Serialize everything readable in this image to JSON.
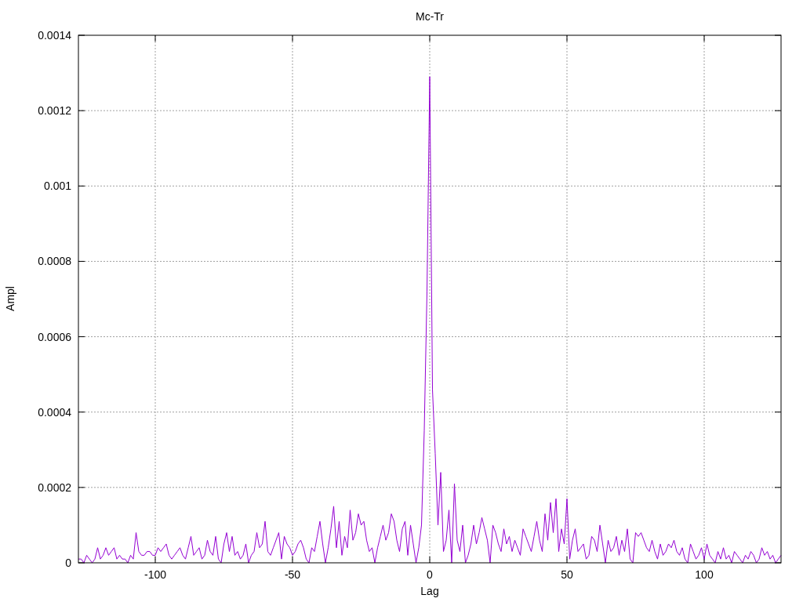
{
  "chart_data": {
    "type": "line",
    "title": "Mc-Tr",
    "xlabel": "Lag",
    "ylabel": "Ampl",
    "xlim": [
      -128,
      128
    ],
    "ylim": [
      0,
      0.0014
    ],
    "xticks": [
      -100,
      -50,
      0,
      50,
      100
    ],
    "yticks": [
      {
        "value": 0,
        "label": "0"
      },
      {
        "value": 0.0002,
        "label": "0.0002"
      },
      {
        "value": 0.0004,
        "label": "0.0004"
      },
      {
        "value": 0.0006,
        "label": "0.0006"
      },
      {
        "value": 0.0008,
        "label": "0.0008"
      },
      {
        "value": 0.001,
        "label": "0.001"
      },
      {
        "value": 0.0012,
        "label": "0.0012"
      },
      {
        "value": 0.0014,
        "label": "0.0014"
      }
    ],
    "grid": true,
    "x": [
      -128,
      -127,
      -126,
      -125,
      -124,
      -123,
      -122,
      -121,
      -120,
      -119,
      -118,
      -117,
      -116,
      -115,
      -114,
      -113,
      -112,
      -111,
      -110,
      -109,
      -108,
      -107,
      -106,
      -105,
      -104,
      -103,
      -102,
      -101,
      -100,
      -99,
      -98,
      -97,
      -96,
      -95,
      -94,
      -93,
      -92,
      -91,
      -90,
      -89,
      -88,
      -87,
      -86,
      -85,
      -84,
      -83,
      -82,
      -81,
      -80,
      -79,
      -78,
      -77,
      -76,
      -75,
      -74,
      -73,
      -72,
      -71,
      -70,
      -69,
      -68,
      -67,
      -66,
      -65,
      -64,
      -63,
      -62,
      -61,
      -60,
      -59,
      -58,
      -57,
      -56,
      -55,
      -54,
      -53,
      -52,
      -51,
      -50,
      -49,
      -48,
      -47,
      -46,
      -45,
      -44,
      -43,
      -42,
      -41,
      -40,
      -39,
      -38,
      -37,
      -36,
      -35,
      -34,
      -33,
      -32,
      -31,
      -30,
      -29,
      -28,
      -27,
      -26,
      -25,
      -24,
      -23,
      -22,
      -21,
      -20,
      -19,
      -18,
      -17,
      -16,
      -15,
      -14,
      -13,
      -12,
      -11,
      -10,
      -9,
      -8,
      -7,
      -6,
      -5,
      -4,
      -3,
      -2,
      -1,
      0,
      1,
      2,
      3,
      4,
      5,
      6,
      7,
      8,
      9,
      10,
      11,
      12,
      13,
      14,
      15,
      16,
      17,
      18,
      19,
      20,
      21,
      22,
      23,
      24,
      25,
      26,
      27,
      28,
      29,
      30,
      31,
      32,
      33,
      34,
      35,
      36,
      37,
      38,
      39,
      40,
      41,
      42,
      43,
      44,
      45,
      46,
      47,
      48,
      49,
      50,
      51,
      52,
      53,
      54,
      55,
      56,
      57,
      58,
      59,
      60,
      61,
      62,
      63,
      64,
      65,
      66,
      67,
      68,
      69,
      70,
      71,
      72,
      73,
      74,
      75,
      76,
      77,
      78,
      79,
      80,
      81,
      82,
      83,
      84,
      85,
      86,
      87,
      88,
      89,
      90,
      91,
      92,
      93,
      94,
      95,
      96,
      97,
      98,
      99,
      100,
      101,
      102,
      103,
      104,
      105,
      106,
      107,
      108,
      109,
      110,
      111,
      112,
      113,
      114,
      115,
      116,
      117,
      118,
      119,
      120,
      121,
      122,
      123,
      124,
      125,
      126,
      127,
      128
    ],
    "series": [
      {
        "color": "#9400d3",
        "values": [
          1e-05,
          1e-05,
          0.0,
          2e-05,
          1e-05,
          0.0,
          1e-05,
          4e-05,
          1e-05,
          2e-05,
          4e-05,
          2e-05,
          3e-05,
          4e-05,
          1e-05,
          2e-05,
          1e-05,
          1e-05,
          0.0,
          2e-05,
          1e-05,
          8e-05,
          3e-05,
          2e-05,
          2e-05,
          3e-05,
          3e-05,
          2e-05,
          2e-05,
          4e-05,
          3e-05,
          4e-05,
          5e-05,
          2e-05,
          1e-05,
          2e-05,
          3e-05,
          4e-05,
          2e-05,
          1e-05,
          4e-05,
          7e-05,
          2e-05,
          3e-05,
          4e-05,
          1e-05,
          2e-05,
          6e-05,
          3e-05,
          2e-05,
          7e-05,
          1e-05,
          0.0,
          5e-05,
          8e-05,
          3e-05,
          7e-05,
          2e-05,
          3e-05,
          1e-05,
          2e-05,
          5e-05,
          0.0,
          2e-05,
          3e-05,
          8e-05,
          4e-05,
          5e-05,
          0.00011,
          3e-05,
          2e-05,
          4e-05,
          6e-05,
          8e-05,
          1e-05,
          7e-05,
          5e-05,
          4e-05,
          2e-05,
          3e-05,
          5e-05,
          6e-05,
          4e-05,
          1e-05,
          0.0,
          4e-05,
          3e-05,
          7e-05,
          0.00011,
          5e-05,
          0.0,
          4e-05,
          9e-05,
          0.00015,
          4e-05,
          0.00011,
          2e-05,
          7e-05,
          4e-05,
          0.00014,
          6e-05,
          8e-05,
          0.00013,
          0.0001,
          0.00011,
          6e-05,
          3e-05,
          4e-05,
          0.0,
          4e-05,
          7e-05,
          0.0001,
          6e-05,
          8e-05,
          0.00013,
          0.00011,
          6e-05,
          3e-05,
          9e-05,
          0.00011,
          2e-05,
          0.0001,
          5e-05,
          0.0,
          4e-05,
          0.0001,
          0.00035,
          0.00072,
          0.00129,
          0.00046,
          0.00029,
          0.0001,
          0.00024,
          3e-05,
          6e-05,
          0.00014,
          0.0,
          0.00021,
          6e-05,
          3e-05,
          0.0001,
          0.0,
          2e-05,
          5e-05,
          0.0001,
          5e-05,
          8e-05,
          0.00012,
          9e-05,
          6e-05,
          0.0,
          0.0001,
          8e-05,
          5e-05,
          3e-05,
          9e-05,
          5e-05,
          7e-05,
          3e-05,
          6e-05,
          4e-05,
          2e-05,
          9e-05,
          7e-05,
          5e-05,
          3e-05,
          7e-05,
          0.00011,
          6e-05,
          3e-05,
          0.00013,
          6e-05,
          0.00016,
          8e-05,
          0.00017,
          3e-05,
          9e-05,
          5e-05,
          0.00017,
          1e-05,
          6e-05,
          9e-05,
          3e-05,
          4e-05,
          5e-05,
          1e-05,
          2e-05,
          7e-05,
          6e-05,
          3e-05,
          0.0001,
          5e-05,
          0.0,
          6e-05,
          3e-05,
          4e-05,
          7e-05,
          2e-05,
          6e-05,
          3e-05,
          9e-05,
          1e-05,
          0.0,
          8e-05,
          7e-05,
          8e-05,
          6e-05,
          4e-05,
          3e-05,
          6e-05,
          3e-05,
          1e-05,
          5e-05,
          2e-05,
          3e-05,
          5e-05,
          4e-05,
          6e-05,
          3e-05,
          2e-05,
          4e-05,
          1e-05,
          0.0,
          5e-05,
          3e-05,
          1e-05,
          2e-05,
          4e-05,
          1e-05,
          5e-05,
          2e-05,
          1e-05,
          0.0,
          3e-05,
          1e-05,
          4e-05,
          1e-05,
          2e-05,
          0.0,
          3e-05,
          2e-05,
          1e-05,
          0.0,
          2e-05,
          1e-05,
          3e-05,
          2e-05,
          0.0,
          1e-05,
          4e-05,
          2e-05,
          3e-05,
          1e-05,
          2e-05,
          0.0,
          1e-05,
          2e-05
        ]
      }
    ]
  }
}
